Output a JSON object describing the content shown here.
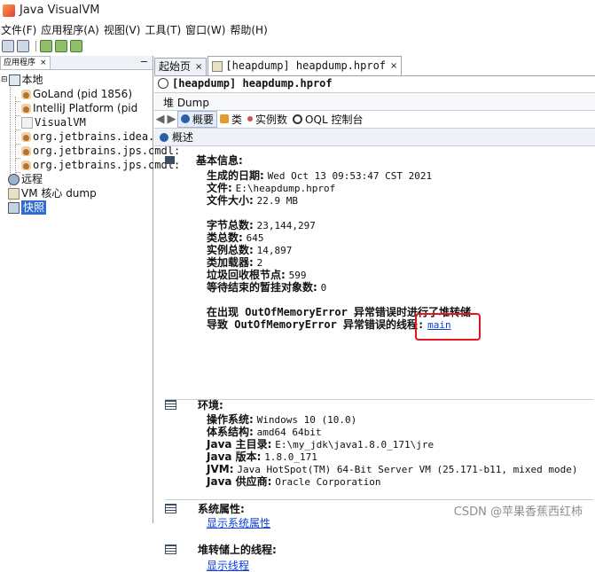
{
  "window": {
    "title": "Java VisualVM"
  },
  "menu": [
    "文件(F)",
    "应用程序(A)",
    "视图(V)",
    "工具(T)",
    "窗口(W)",
    "帮助(H)"
  ],
  "left_panel": {
    "tab_label": "应用程序",
    "tab_close": "×",
    "minimize": "−",
    "tree": {
      "local": "本地",
      "goland": "GoLand (pid 1856)",
      "intellij": "IntelliJ Platform (pid",
      "visualvm": "VisualVM",
      "proc1": "org.jetbrains.idea.mave",
      "proc2": "org.jetbrains.jps.cmdl:",
      "proc3": "org.jetbrains.jps.cmdl:",
      "remote": "远程",
      "vmcore": "VM 核心 dump",
      "snapshots": "快照"
    }
  },
  "doc_tabs": [
    {
      "label": "起始页",
      "close": "×"
    },
    {
      "label": "[heapdump] heapdump.hprof",
      "close": "×"
    }
  ],
  "heap": {
    "title": "[heapdump] heapdump.hprof",
    "stack_label": "堆 Dump",
    "nav": {
      "summary": "概要",
      "classes": "类",
      "instances": "实例数",
      "oql": "OQL 控制台"
    },
    "section_title": "概述"
  },
  "basic": {
    "title": "基本信息:",
    "date_label": "生成的日期:",
    "date_value": "Wed Oct 13 09:53:47 CST 2021",
    "file_label": "文件:",
    "file_value": "E:\\heapdump.hprof",
    "size_label": "文件大小:",
    "size_value": "22.9 MB",
    "bytes_label": "字节总数:",
    "bytes_value": "23,144,297",
    "classes_label": "类总数:",
    "classes_value": "645",
    "instances_label": "实例总数:",
    "instances_value": "14,897",
    "loaders_label": "类加载器:",
    "loaders_value": "2",
    "gcroots_label": "垃圾回收根节点:",
    "gcroots_value": "599",
    "pending_label": "等待结束的暂挂对象数:",
    "pending_value": "0",
    "oom_line1": "在出现 OutOfMemoryError 异常错误时进行了堆转储",
    "oom_line2": "导致 OutOfMemoryError 异常错误的线程:",
    "oom_thread": "main"
  },
  "env": {
    "title": "环境:",
    "os_label": "操作系统:",
    "os_value": "Windows 10 (10.0)",
    "arch_label": "体系结构:",
    "arch_value": "amd64 64bit",
    "home_label": "Java 主目录:",
    "home_value": "E:\\my_jdk\\java1.8.0_171\\jre",
    "version_label": "Java 版本:",
    "version_value": "1.8.0_171",
    "jvm_label": "JVM:",
    "jvm_value": "Java HotSpot(TM) 64-Bit Server VM (25.171-b11, mixed mode)",
    "vendor_label": "Java 供应商:",
    "vendor_value": "Oracle Corporation"
  },
  "sysprops": {
    "title": "系统属性:",
    "link": "显示系统属性"
  },
  "threads": {
    "title": "堆转储上的线程:",
    "link": "显示线程"
  },
  "watermark": "CSDN @苹果香蕉西红柿",
  "colors": {
    "selection": "#2f6ccf",
    "link": "#0a3fd1",
    "highlight_box": "#e3161e"
  }
}
